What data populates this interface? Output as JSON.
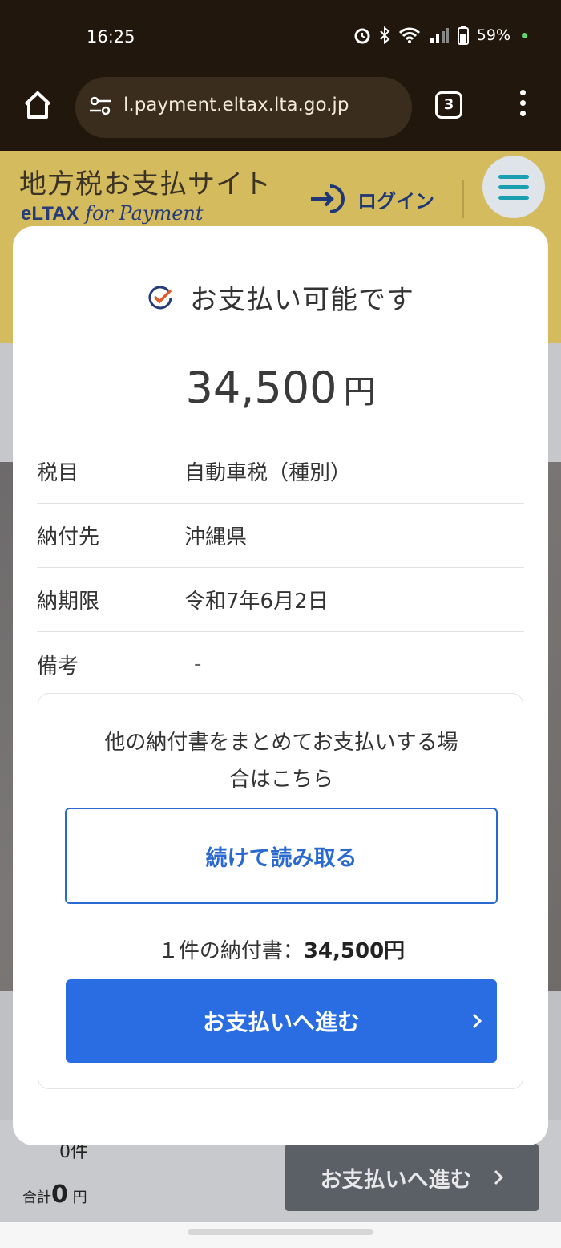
{
  "status_bar": {
    "time": "16:25",
    "battery": "59%"
  },
  "browser": {
    "url": "l.payment.eltax.lta.go.jp",
    "tab_count": "3"
  },
  "site": {
    "title": "地方税お支払サイト",
    "logo_main": "eLTAX",
    "logo_sub": "for Payment",
    "login_label": "ログイン"
  },
  "modal": {
    "title": "お支払い可能です",
    "amount": "34,500",
    "currency": "円",
    "rows": [
      {
        "label": "税目",
        "value": "自動車税（種別）"
      },
      {
        "label": "納付先",
        "value": "沖縄県"
      },
      {
        "label": "納期限",
        "value": "令和7年6月2日"
      },
      {
        "label": "備考",
        "value": "-"
      }
    ],
    "other_notice_line1": "他の納付書をまとめてお支払いする場",
    "other_notice_line2": "合はこちら",
    "continue_label": "続けて読み取る",
    "summary_prefix": "１件の納付書：",
    "summary_amount": "34,500円",
    "pay_label": "お支払いへ進む"
  },
  "background_page": {
    "count": "0件",
    "total_label": "合計",
    "total_value": "0",
    "total_unit": "円",
    "pay_label": "お支払いへ進む"
  },
  "colors": {
    "accent": "#2a6de3",
    "header": "#d4bb5d",
    "navy": "#1d3777"
  }
}
